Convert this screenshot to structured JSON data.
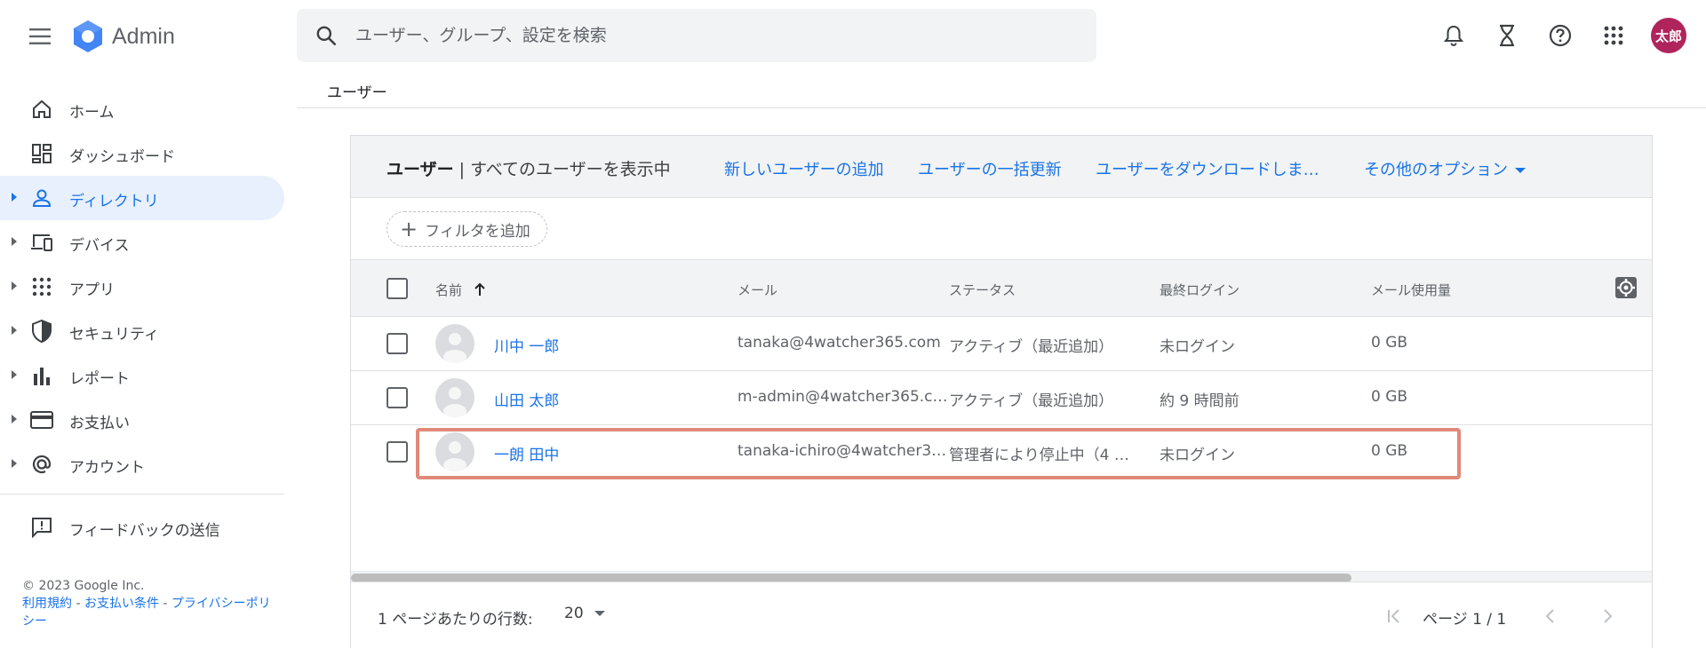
{
  "app": {
    "name": "Admin"
  },
  "search": {
    "placeholder": "ユーザー、グループ、設定を検索"
  },
  "user": {
    "avatar_text": "太郎",
    "avatar_color": "#b0245c"
  },
  "sidebar": {
    "items": [
      {
        "label": "ホーム",
        "icon": "home-icon"
      },
      {
        "label": "ダッシュボード",
        "icon": "dashboard-icon"
      },
      {
        "label": "ディレクトリ",
        "icon": "person-icon",
        "active": true
      },
      {
        "label": "デバイス",
        "icon": "devices-icon"
      },
      {
        "label": "アプリ",
        "icon": "apps-grid-icon"
      },
      {
        "label": "セキュリティ",
        "icon": "shield-icon"
      },
      {
        "label": "レポート",
        "icon": "bar-chart-icon"
      },
      {
        "label": "お支払い",
        "icon": "credit-card-icon"
      },
      {
        "label": "アカウント",
        "icon": "at-sign-icon"
      }
    ],
    "feedback": "フィードバックの送信"
  },
  "footer": {
    "copyright": "© 2023 Google Inc.",
    "terms": "利用規約",
    "sep1": " - ",
    "billing_terms": "お支払い条件",
    "sep2": " - ",
    "privacy": "プライバシーポリシー"
  },
  "breadcrumb": "ユーザー",
  "card": {
    "title": "ユーザー",
    "subtitle": " | すべてのユーザーを表示中",
    "actions": {
      "add_user": "新しいユーザーの追加",
      "bulk_update": "ユーザーの一括更新",
      "download": "ユーザーをダウンロードしま…",
      "more": "その他のオプション"
    },
    "filter": "フィルタを追加"
  },
  "table": {
    "columns": {
      "name": "名前",
      "email": "メール",
      "status": "ステータス",
      "last_login": "最終ログイン",
      "mail_usage": "メール使用量"
    },
    "rows": [
      {
        "name": "川中 一郎",
        "email": "tanaka@4watcher365.com",
        "status": "アクティブ（最近追加）",
        "last_login": "未ログイン",
        "usage": "0 GB"
      },
      {
        "name": "山田 太郎",
        "email": "m-admin@4watcher365.c…",
        "status": "アクティブ（最近追加）",
        "last_login": "約 9 時間前",
        "usage": "0 GB"
      },
      {
        "name": "一朗 田中",
        "email": "tanaka-ichiro@4watcher3…",
        "status": "管理者により停止中（4 …",
        "last_login": "未ログイン",
        "usage": "0 GB"
      }
    ]
  },
  "pager": {
    "rows_label": "1 ページあたりの行数:",
    "rows_value": "20",
    "page_text": "ページ 1 / 1"
  },
  "colors": {
    "accent": "#1a73e8",
    "highlight": "#e0897a"
  }
}
